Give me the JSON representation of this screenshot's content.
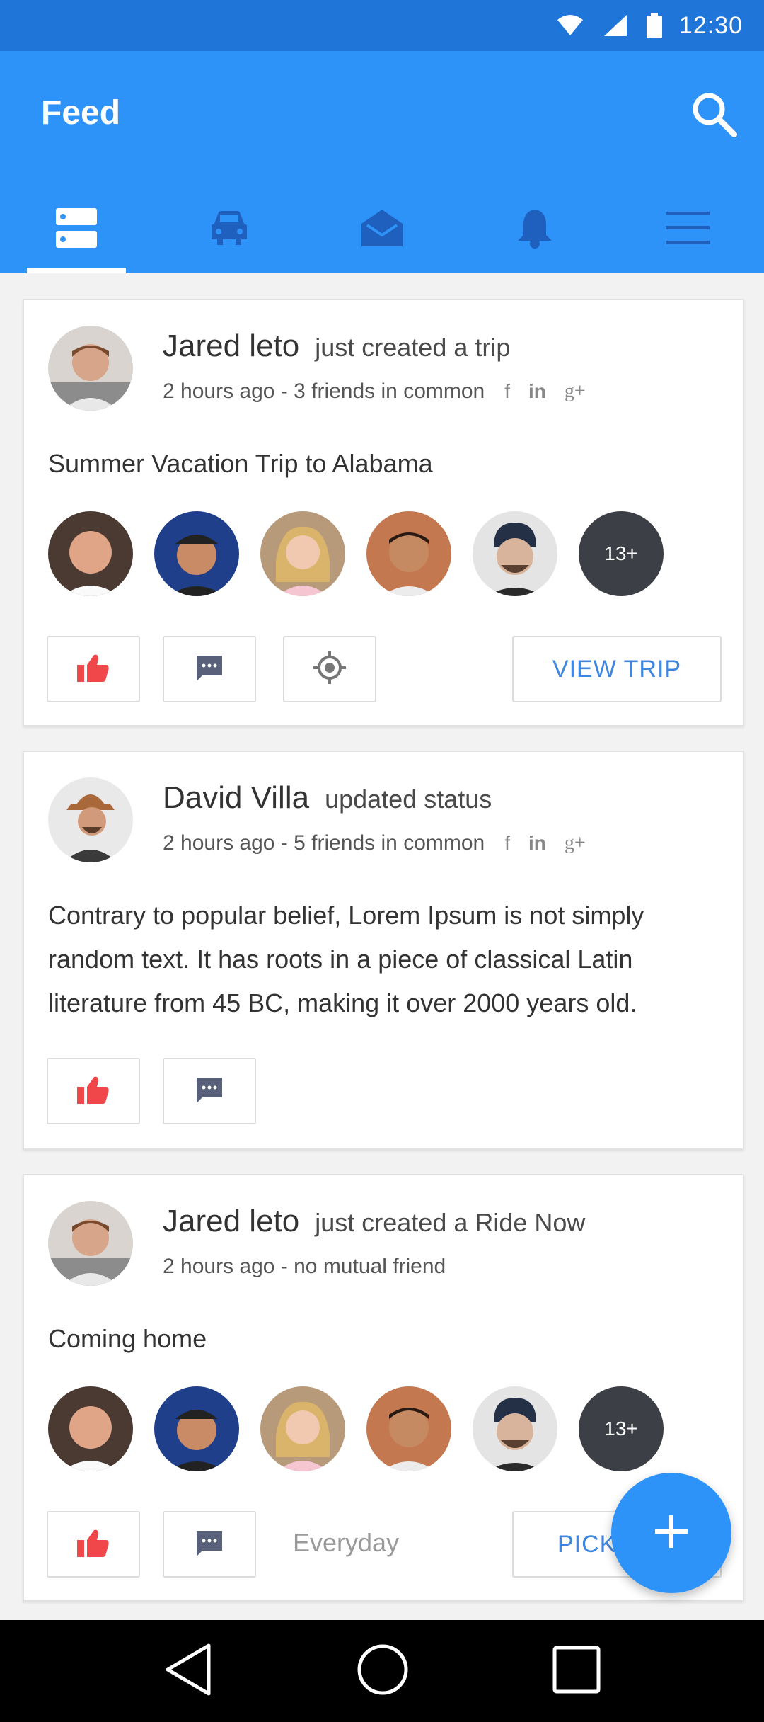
{
  "status_bar": {
    "time": "12:30"
  },
  "app_bar": {
    "title": "Feed",
    "tabs": [
      {
        "icon": "feed-icon",
        "active": true
      },
      {
        "icon": "car-icon",
        "active": false
      },
      {
        "icon": "mail-icon",
        "active": false
      },
      {
        "icon": "bell-icon",
        "active": false
      },
      {
        "icon": "menu-icon",
        "active": false
      }
    ]
  },
  "colors": {
    "status_bar": "#1f76d8",
    "primary": "#2d93f8",
    "like_red": "#f0484a",
    "link_blue": "#3f86e0"
  },
  "posts": [
    {
      "name": "Jared leto",
      "action": "just created a trip",
      "meta": "2 hours ago - 3 friends in common",
      "social": [
        "f",
        "in",
        "g+"
      ],
      "text": "Summer Vacation Trip to Alabama",
      "more_count": "13+",
      "cta": "VIEW TRIP"
    },
    {
      "name": "David Villa",
      "action": "updated status",
      "meta": "2 hours ago - 5 friends in common",
      "social": [
        "f",
        "in",
        "g+"
      ],
      "text": "Contrary to popular belief, Lorem Ipsum is not simply random text. It has roots in a piece of classical Latin literature from 45 BC, making it over 2000 years old."
    },
    {
      "name": "Jared leto",
      "action": "just created a Ride Now",
      "meta": "2 hours ago - no mutual friend",
      "text": "Coming home",
      "more_count": "13+",
      "schedule": "Everyday",
      "cta": "PICK"
    }
  ]
}
